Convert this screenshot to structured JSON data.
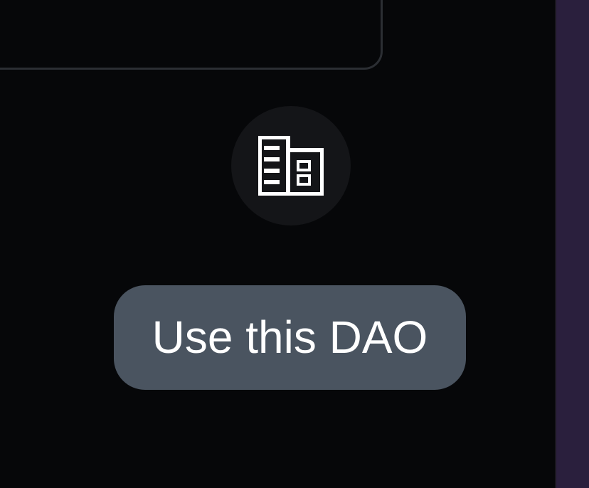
{
  "dao_card": {
    "icon": "building-icon",
    "action_label": "Use this DAO"
  },
  "colors": {
    "background": "#060709",
    "card_border": "#2b2e33",
    "avatar_bg": "#141518",
    "button_bg": "#4a5460",
    "button_text": "#ffffff",
    "side_strip": "#2a1f3d"
  }
}
